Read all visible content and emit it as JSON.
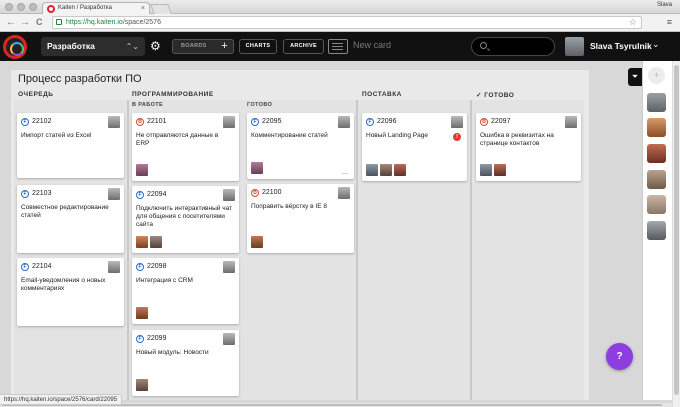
{
  "browser": {
    "tab_title": "Kaiten / Разработка",
    "tab_close": "×",
    "user": "Slava",
    "nav_back": "←",
    "nav_forward": "→",
    "nav_reload": "C",
    "url_scheme_host": "https://hq.kaiten.io",
    "url_path": "/space/2576",
    "star": "☆",
    "menu": "≡",
    "status_url": "https://hq.kaiten.io/space/2576/card/22095"
  },
  "header": {
    "space_name": "Разработка",
    "space_chevrons": "⌃⌄",
    "gear": "⚙",
    "boards_label": "BOARDS",
    "boards_plus": "+",
    "charts_label": "CHARTS",
    "archive_label": "ARCHIVE",
    "new_card_label": "New card",
    "user_name": "Slava Tsyrulnik",
    "user_chevron": "⌄"
  },
  "board": {
    "title": "Процесс разработки ПО",
    "columns": [
      {
        "label": "ОЧЕРЕДЬ"
      },
      {
        "label": "ПРОГРАММИРОВАНИЕ",
        "subcolumns": [
          {
            "label": "В РАБОТЕ"
          },
          {
            "label": "ГОТОВО"
          }
        ]
      },
      {
        "label": "ПОСТАВКА"
      },
      {
        "label": "✓ ГОТОВО"
      }
    ],
    "cards": [
      {
        "id": "22102",
        "type": "F",
        "title": "Импорт статей из Excel"
      },
      {
        "id": "22103",
        "type": "F",
        "title": "Совместное редактирование статей"
      },
      {
        "id": "22104",
        "type": "F",
        "title": "Email-уведомления о новых комментариях"
      },
      {
        "id": "22101",
        "type": "B",
        "title": "Не отправляются данные в ERP"
      },
      {
        "id": "22094",
        "type": "F",
        "title": "Подключить интерактивный чат для общения с посетителями сайта"
      },
      {
        "id": "22098",
        "type": "F",
        "title": "Интеграция с CRM"
      },
      {
        "id": "22099",
        "type": "F",
        "title": "Новый модуль: Новости"
      },
      {
        "id": "22095",
        "type": "F",
        "title": "Комментирование статей",
        "more": "..."
      },
      {
        "id": "22100",
        "type": "B",
        "title": "Поправить вёрстку в IE 8"
      },
      {
        "id": "22096",
        "type": "F",
        "title": "Новый Landing Page",
        "alert": "!"
      },
      {
        "id": "22097",
        "type": "B",
        "title": "Ошибка в реквизитах на странице контактов"
      }
    ]
  },
  "rail": {
    "add_icon": "+",
    "filter_icon": "⏷"
  },
  "fab": {
    "label": "?"
  },
  "colors": {
    "header_bg": "#111111",
    "accent": "#8e3ee0",
    "feature": "#2d6bc9",
    "bug": "#d24b2b"
  }
}
